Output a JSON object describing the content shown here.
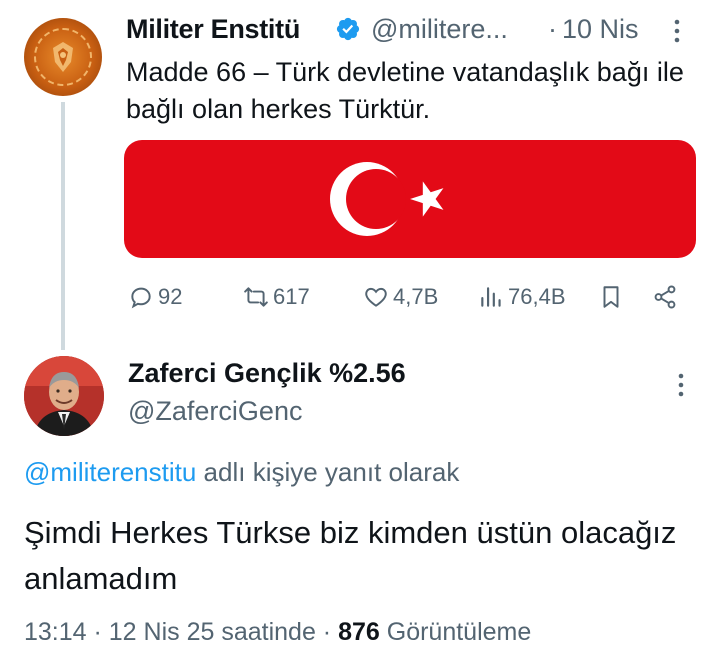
{
  "tweet1": {
    "author_name": "Militer Enstitü",
    "handle": "@militere...",
    "separator": "·",
    "date": "10 Nis",
    "text": "Madde 66 – Türk devletine vatandaşlık bağı ile bağlı olan herkes Türktür.",
    "image": "turkish-flag",
    "actions": {
      "replies": "92",
      "reposts": "617",
      "likes": "4,7B",
      "views": "76,4B"
    }
  },
  "tweet2": {
    "author_name": "Zaferci Gençlik %2.56",
    "handle": "@ZaferciGenc",
    "reply_to_mention": "@militerenstitu",
    "reply_to_suffix": " adlı kişiye yanıt olarak",
    "text": "Şimdi Herkes Türkse biz kimden üstün olacağız anlamadım",
    "time": "13:14",
    "date": " · 12 Nis 25 saatinde · ",
    "view_count": "876",
    "view_label": " Görüntüleme"
  },
  "colors": {
    "text_primary": "#0f1419",
    "text_secondary": "#536471",
    "link": "#1d9bf0",
    "verified": "#1d9bf0",
    "flag_red": "#e30a17",
    "thread_line": "#cfd9de"
  }
}
